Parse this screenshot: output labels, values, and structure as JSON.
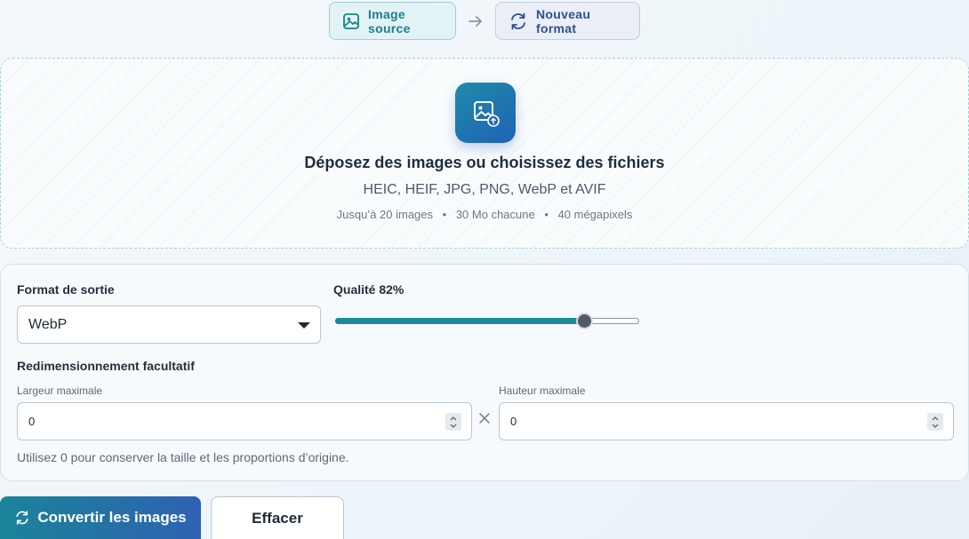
{
  "steps": {
    "source_label": "Image source",
    "target_label": "Nouveau format"
  },
  "dropzone": {
    "title": "Déposez des images ou choisissez des fichiers",
    "formats": "HEIC, HEIF, JPG, PNG, WebP et AVIF",
    "limit_count": "Jusqu’à 20 images",
    "limit_size": "30 Mo chacune",
    "limit_pixels": "40 mégapixels"
  },
  "settings": {
    "format_label": "Format de sortie",
    "format_value": "WebP",
    "quality_label": "Qualité 82%",
    "quality_percent": 82,
    "resize_label": "Redimensionnement facultatif",
    "max_width_label": "Largeur maximale",
    "max_width_value": "0",
    "max_height_label": "Hauteur maximale",
    "max_height_value": "0",
    "hint": "Utilisez 0 pour conserver la taille et les proportions d’origine."
  },
  "actions": {
    "convert_label": "Convertir les images",
    "clear_label": "Effacer"
  },
  "colors": {
    "accent_teal": "#1b8b98",
    "accent_blue": "#2e61b3"
  }
}
